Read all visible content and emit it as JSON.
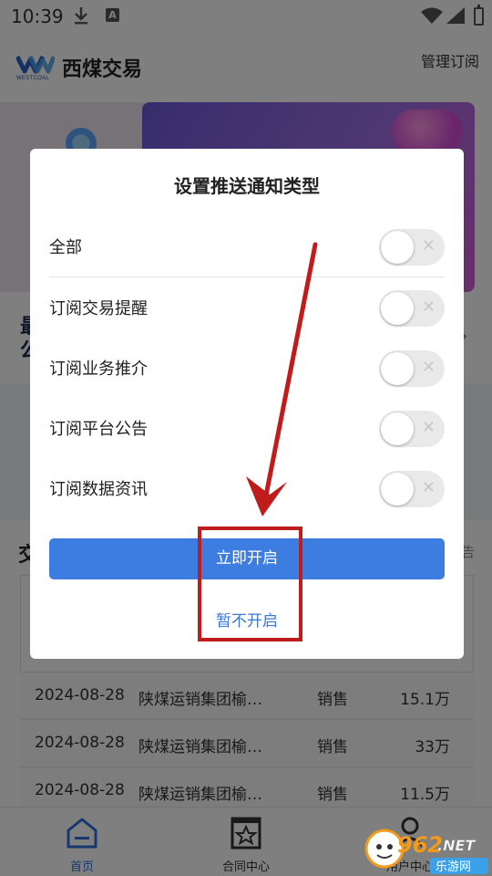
{
  "status_bar": {
    "time": "10:39",
    "icons": [
      "download-icon",
      "a-notification-icon",
      "wifi-icon",
      "signal-icon",
      "battery-icon"
    ]
  },
  "header": {
    "logo_text": "WESTCOAL",
    "title": "西煤交易",
    "manage_link": "管理订阅"
  },
  "page_behind": {
    "promo_text": "最\n公",
    "section_title": "交",
    "section_more": "告",
    "trades": [
      {
        "date": "2024-08-28",
        "name": "陕煤运销集团榆…",
        "type": "销售",
        "amount": "15.1万"
      },
      {
        "date": "2024-08-28",
        "name": "陕煤运销集团榆…",
        "type": "销售",
        "amount": "33万"
      },
      {
        "date": "2024-08-28",
        "name": "陕煤运销集团榆…",
        "type": "销售",
        "amount": "11.5万"
      }
    ]
  },
  "modal": {
    "title": "设置推送通知类型",
    "options": [
      {
        "label": "全部",
        "enabled": false
      },
      {
        "label": "订阅交易提醒",
        "enabled": false
      },
      {
        "label": "订阅业务推介",
        "enabled": false
      },
      {
        "label": "订阅平台公告",
        "enabled": false
      },
      {
        "label": "订阅数据资讯",
        "enabled": false
      }
    ],
    "toggle_off_glyph": "✕",
    "confirm_label": "立即开启",
    "cancel_label": "暂不开启"
  },
  "bottom_nav": {
    "items": [
      {
        "label": "首页",
        "icon": "home-icon",
        "active": true
      },
      {
        "label": "合同中心",
        "icon": "contract-icon",
        "active": false
      },
      {
        "label": "用户中心",
        "icon": "user-icon",
        "active": false
      }
    ]
  },
  "watermark": {
    "brand": "962",
    "suffix": ".NET",
    "cn": "乐游网"
  },
  "colors": {
    "primary": "#3d7de2",
    "link": "#3a78d6",
    "annotation": "#c01c1c",
    "nav_active": "#2f6fe3"
  }
}
